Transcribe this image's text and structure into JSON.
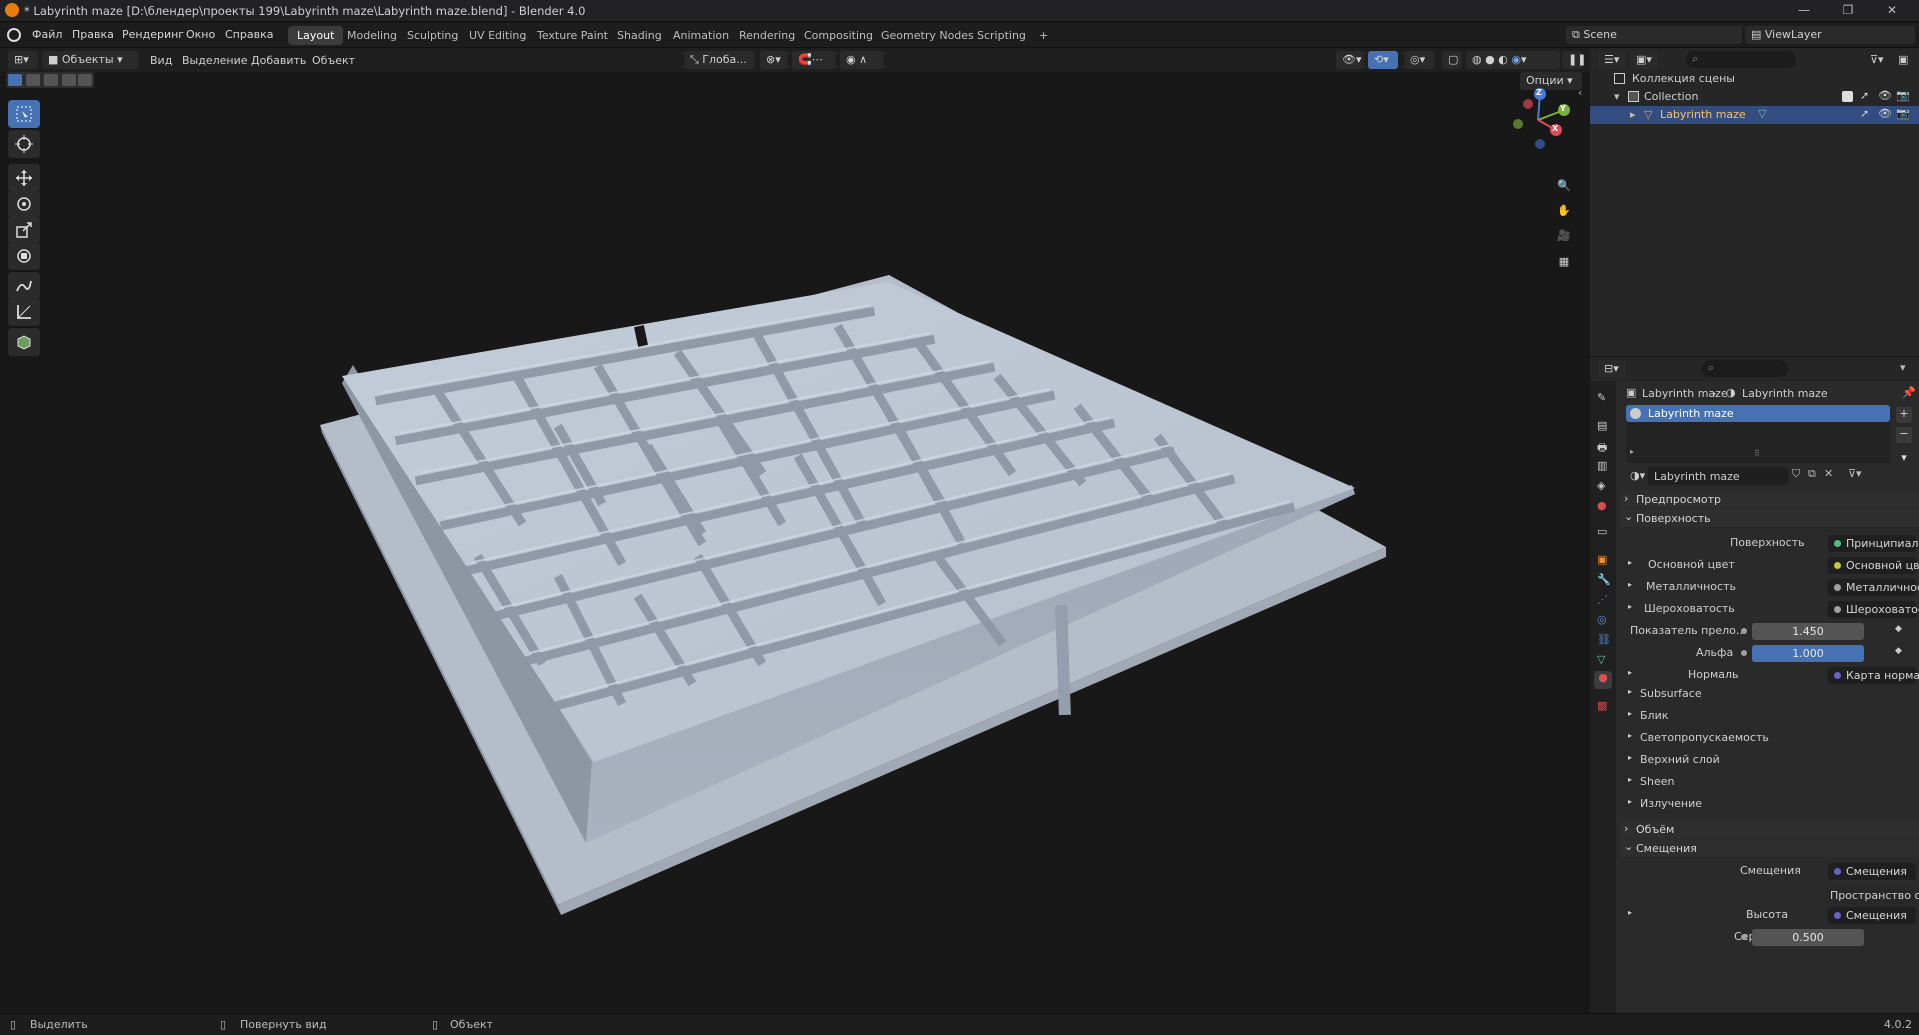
{
  "app": {
    "title": "* Labyrinth maze [D:\\блендер\\проекты 199\\Labyrinth maze\\Labyrinth maze.blend] - Blender 4.0"
  },
  "menu": [
    "Файл",
    "Правка",
    "Рендеринг",
    "Окно",
    "Справка"
  ],
  "workspaces": [
    "Layout",
    "Modeling",
    "Sculpting",
    "UV Editing",
    "Texture Paint",
    "Shading",
    "Animation",
    "Rendering",
    "Compositing",
    "Geometry Nodes",
    "Scripting",
    "+"
  ],
  "active_workspace": "Layout",
  "scene": {
    "name": "Scene",
    "viewlayer": "ViewLayer"
  },
  "viewport_header": {
    "mode": "Объекты",
    "menus": [
      "Вид",
      "Выделение",
      "Добавить",
      "Объект"
    ],
    "orientation": "Глоба...",
    "options": "Опции"
  },
  "gizmo": {
    "z": "Z",
    "y": "Y",
    "x": "X"
  },
  "outliner": {
    "root": "Коллекция сцены",
    "collection": "Collection",
    "object": "Labyrinth maze"
  },
  "properties": {
    "breadcrumb_object": "Labyrinth maze",
    "breadcrumb_material": "Labyrinth maze",
    "slot": "Labyrinth maze",
    "material_name": "Labyrinth maze",
    "preview": "Предпросмотр",
    "surface_section": "Поверхность",
    "surface_label": "Поверхность",
    "surface_value": "Принципиальный BSDF",
    "rows": [
      {
        "label": "Основной цвет",
        "value": "Основной цвет",
        "dot": "#c6c83a"
      },
      {
        "label": "Металличность",
        "value": "Металличность",
        "dot": "#a0a0a0"
      },
      {
        "label": "Шероховатость",
        "value": "Шероховатость",
        "dot": "#a0a0a0"
      }
    ],
    "ior_label": "Показатель прело...",
    "ior_value": "1.450",
    "alpha_label": "Альфа",
    "alpha_value": "1.000",
    "normal_label": "Нормаль",
    "normal_value": "Карта нормалей",
    "subsections": [
      "Subsurface",
      "Блик",
      "Светопропускаемость",
      "Верхний слой",
      "Sheen",
      "Излучение"
    ],
    "volume_section": "Объём",
    "disp_section": "Смещения",
    "disp_label": "Смещения",
    "disp_value": "Смещения",
    "space_value": "Пространство объекта",
    "height_label": "Высота",
    "height_value": "Смещения",
    "mid_label": "Середина",
    "mid_value": "0.500"
  },
  "status": {
    "select": "Выделить",
    "rotate": "Повернуть вид",
    "object": "Объект",
    "version": "4.0.2"
  }
}
